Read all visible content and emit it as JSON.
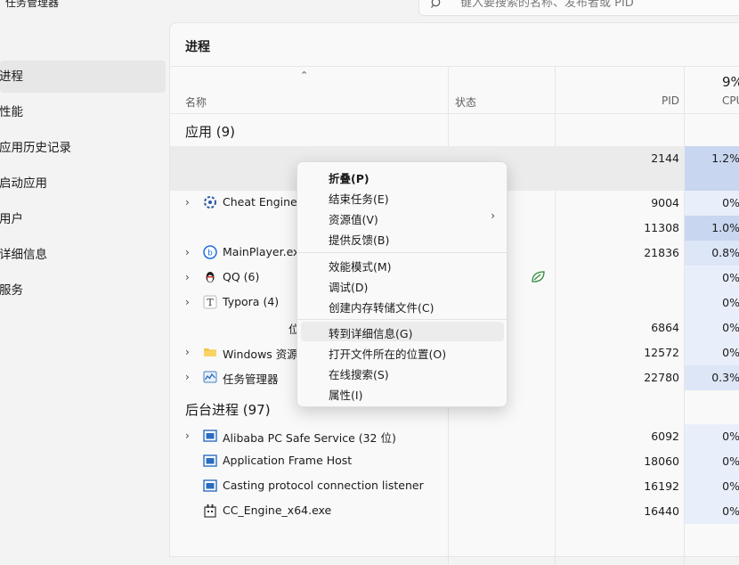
{
  "app": {
    "title": "任务管理器"
  },
  "search": {
    "placeholder": "键入要搜索的名称、发布者或 PID"
  },
  "nav": {
    "items": [
      {
        "label": "进程",
        "active": true
      },
      {
        "label": "性能"
      },
      {
        "label": "应用历史记录"
      },
      {
        "label": "启动应用"
      },
      {
        "label": "用户"
      },
      {
        "label": "详细信息"
      },
      {
        "label": "服务"
      }
    ]
  },
  "panel": {
    "title": "进程"
  },
  "columns": {
    "name": "名称",
    "status": "状态",
    "pid": "PID",
    "cpu": "CPU",
    "cpu_total": "9%"
  },
  "sections": {
    "apps": "应用 (9)",
    "background": "后台进程 (97)"
  },
  "app_rows": [
    {
      "name": "",
      "pid": "2144",
      "cpu": "1.2%"
    },
    {
      "name": "Cheat Engine",
      "pid": "9004",
      "cpu": "0%"
    },
    {
      "name": "",
      "pid": "11308",
      "cpu": "1.0%"
    },
    {
      "name": "MainPlayer.exe",
      "pid": "21836",
      "cpu": "0.8%"
    },
    {
      "name": "QQ (6)",
      "pid": "",
      "cpu": "0%"
    },
    {
      "name": "Typora (4)",
      "pid": "",
      "cpu": "0%"
    },
    {
      "name": "位",
      "pid": "6864",
      "cpu": "0%"
    },
    {
      "name": "Windows 资源",
      "pid": "12572",
      "cpu": "0%"
    },
    {
      "name": "任务管理器",
      "pid": "22780",
      "cpu": "0.3%"
    }
  ],
  "bg_rows": [
    {
      "name": "Alibaba PC Safe Service (32 位)",
      "pid": "6092",
      "cpu": "0%"
    },
    {
      "name": "Application Frame Host",
      "pid": "18060",
      "cpu": "0%"
    },
    {
      "name": "Casting protocol connection listener",
      "pid": "16192",
      "cpu": "0%"
    },
    {
      "name": "CC_Engine_x64.exe",
      "pid": "16440",
      "cpu": "0%"
    }
  ],
  "context_menu": {
    "items": [
      "折叠(P)",
      "结束任务(E)",
      "资源值(V)",
      "提供反馈(B)",
      "效能模式(M)",
      "调试(D)",
      "创建内存转储文件(C)",
      "转到详细信息(G)",
      "打开文件所在的位置(O)",
      "在线搜索(S)",
      "属性(I)"
    ]
  },
  "colors": {
    "cpu_high": "#c9d6f0",
    "cpu_mid": "#dde6f7",
    "cpu_low": "#e9effa",
    "accent": "#0067c0"
  }
}
